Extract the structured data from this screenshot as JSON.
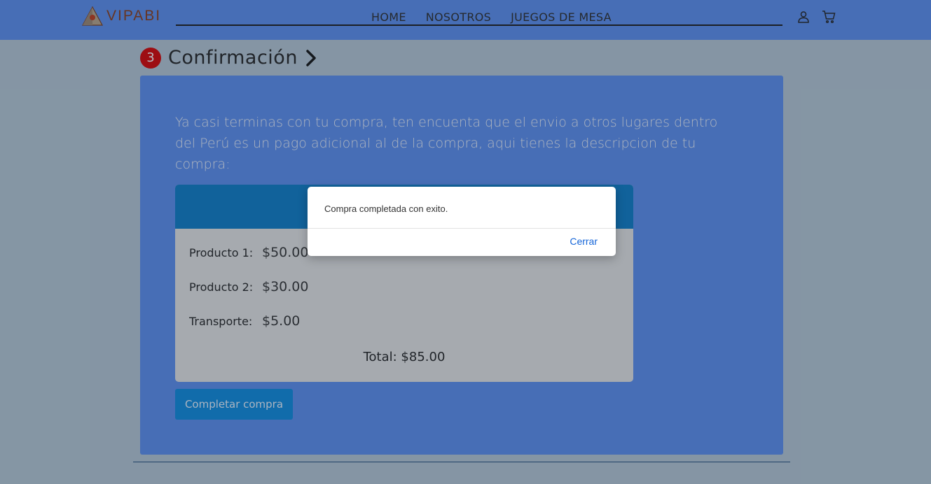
{
  "header": {
    "brand": "VIPABI",
    "nav": [
      "HOME",
      "NOSOTROS",
      "JUEGOS DE MESA"
    ],
    "user_icon": "user-icon",
    "cart_icon": "cart-icon"
  },
  "step": {
    "number": "3",
    "title": "Confirmación"
  },
  "panel": {
    "description": "Ya casi terminas con tu compra, ten encuenta que el envio a otros lugares dentro del Perú es un pago adicional al de la compra, aqui tienes la descripcion de tu compra:",
    "items": [
      {
        "label": "Producto 1:",
        "value": "$50.00"
      },
      {
        "label": "Producto 2:",
        "value": "$30.00"
      },
      {
        "label": "Transporte:",
        "value": "$5.00"
      }
    ],
    "total": "Total: $85.00",
    "button": "Completar compra"
  },
  "dialog": {
    "message": "Compra completada con exito.",
    "close": "Cerrar"
  },
  "colors": {
    "header_bg": "#5a8ef0",
    "panel_bg": "#5a8ef0",
    "card_header": "#0b7dc9",
    "button_bg": "#0b8be0",
    "step_badge": "#d90000",
    "dialog_action": "#1565d8"
  }
}
